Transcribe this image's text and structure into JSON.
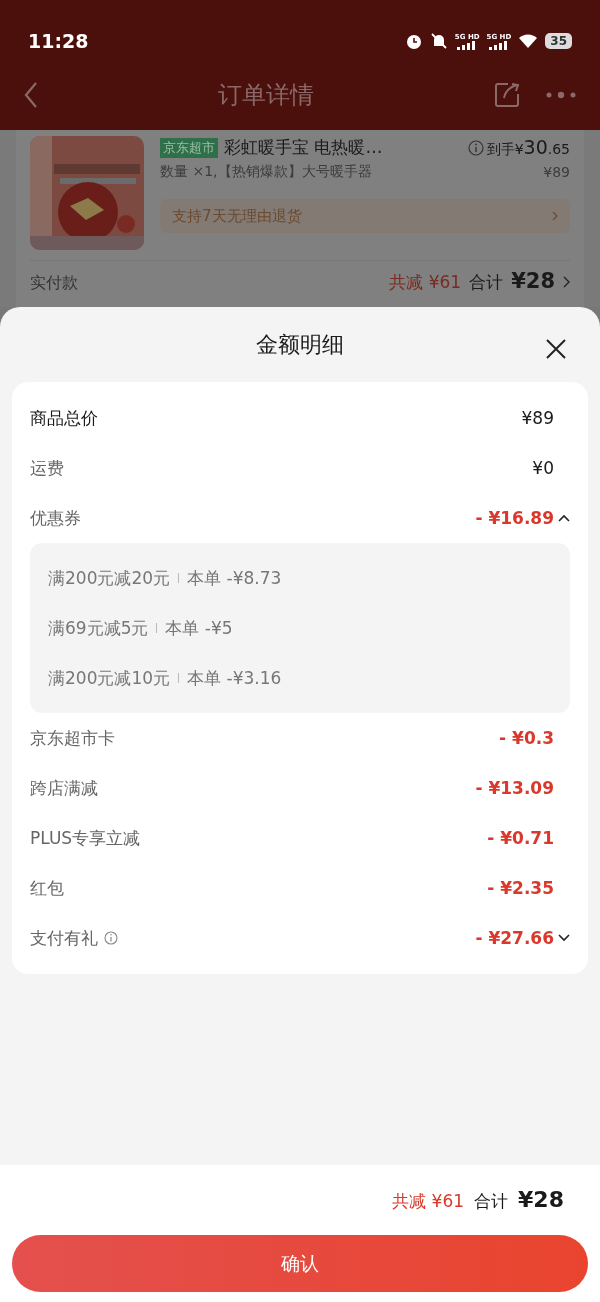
{
  "status_bar": {
    "time": "11:28",
    "signals": [
      {
        "label": "5G HD"
      },
      {
        "label": "5G HD"
      }
    ],
    "battery": "35"
  },
  "nav": {
    "title": "订单详情"
  },
  "product": {
    "tag": "京东超市",
    "name": "彩虹暖手宝 电热暖…",
    "spec": "数量 ×1,【热销爆款】大号暖手器",
    "final_price": {
      "prefix": "到手¥",
      "integer": "30",
      "decimals": ".65"
    },
    "original_price": "¥89",
    "return_policy": "支持7天无理由退货"
  },
  "payment": {
    "label": "实付款",
    "discount": "共减 ¥61",
    "total_label": "合计",
    "total": "¥28"
  },
  "sheet": {
    "title": "金额明细",
    "rows": [
      {
        "label": "商品总价",
        "value": "¥89",
        "kind": "total"
      },
      {
        "label": "运费",
        "value": "¥0",
        "kind": "plain"
      },
      {
        "label": "优惠券",
        "value": "- ¥16.89",
        "kind": "discount",
        "expanded": true,
        "items": [
          {
            "rule": "满200元减20元",
            "amount": "本单 -¥8.73"
          },
          {
            "rule": "满69元减5元",
            "amount": "本单 -¥5"
          },
          {
            "rule": "满200元减10元",
            "amount": "本单 -¥3.16"
          }
        ]
      },
      {
        "label": "京东超市卡",
        "value": "- ¥0.3",
        "kind": "discount"
      },
      {
        "label": "跨店满减",
        "value": "- ¥13.09",
        "kind": "discount"
      },
      {
        "label": "PLUS专享立减",
        "value": "- ¥0.71",
        "kind": "discount"
      },
      {
        "label": "红包",
        "value": "- ¥2.35",
        "kind": "discount"
      },
      {
        "label": "支付有礼",
        "value": "- ¥27.66",
        "kind": "discount",
        "info": true,
        "expanded": false
      }
    ]
  },
  "footer": {
    "discount": "共减 ¥61",
    "total_label": "合计",
    "total": "¥28",
    "confirm": "确认"
  }
}
